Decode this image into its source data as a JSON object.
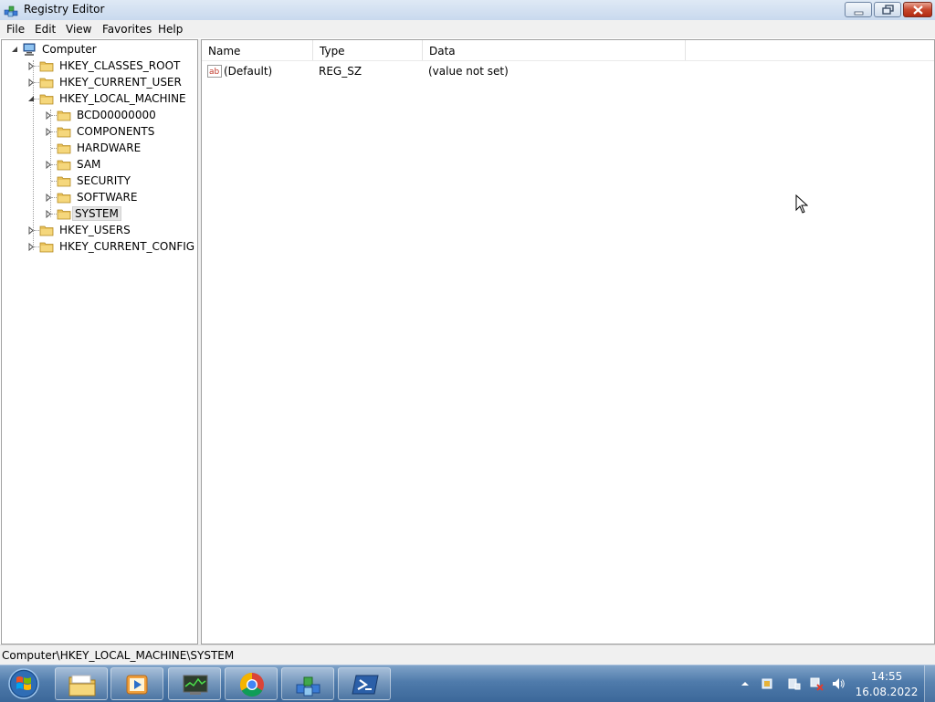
{
  "window": {
    "title": "Registry Editor"
  },
  "menu": [
    "File",
    "Edit",
    "View",
    "Favorites",
    "Help"
  ],
  "tree": {
    "root": "Computer",
    "hives": [
      "HKEY_CLASSES_ROOT",
      "HKEY_CURRENT_USER",
      "HKEY_LOCAL_MACHINE",
      "HKEY_USERS",
      "HKEY_CURRENT_CONFIG"
    ],
    "hklm_children": [
      "BCD00000000",
      "COMPONENTS",
      "HARDWARE",
      "SAM",
      "SECURITY",
      "SOFTWARE",
      "SYSTEM"
    ],
    "selected": "SYSTEM"
  },
  "list": {
    "columns": [
      "Name",
      "Type",
      "Data"
    ],
    "rows": [
      {
        "name": "(Default)",
        "type": "REG_SZ",
        "data": "(value not set)",
        "icon": "string-value-icon"
      }
    ]
  },
  "status": {
    "path": "Computer\\HKEY_LOCAL_MACHINE\\SYSTEM"
  },
  "taskbar": {
    "apps": [
      "explorer-icon",
      "media-player-icon",
      "task-manager-icon",
      "chrome-icon",
      "regedit-icon",
      "powershell-icon"
    ],
    "clock_time": "14:55",
    "clock_date": "16.08.2022"
  },
  "colors": {
    "folder": "#e8c15a",
    "taskbar": "#4f7bab",
    "selection": "#e5e5e5"
  }
}
